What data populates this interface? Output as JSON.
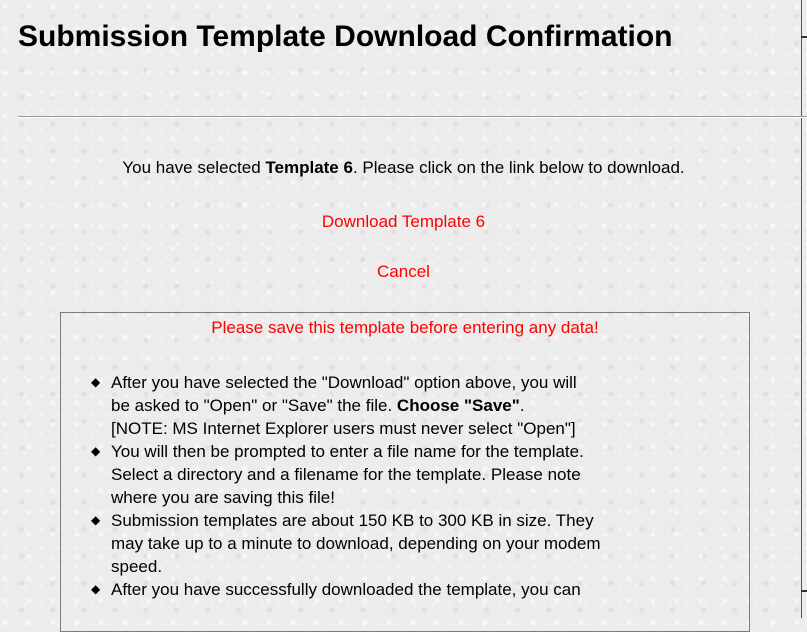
{
  "page": {
    "title": "Submission Template Download Confirmation"
  },
  "intro": {
    "prefix": "You have selected ",
    "template_name": "Template 6",
    "suffix": ". Please click on the link below to download."
  },
  "links": {
    "download": "Download Template 6",
    "cancel": "Cancel"
  },
  "notice": {
    "heading": "Please save this template before entering any data!",
    "items": [
      {
        "line1": "After you have selected the \"Download\" option above, you will",
        "line2_prefix": "be asked to \"Open\" or \"Save\" the file. ",
        "line2_bold": "Choose \"Save\"",
        "line2_suffix": ".",
        "line3": "[NOTE: MS Internet Explorer users must never select \"Open\"]"
      },
      {
        "line1": "You will then be prompted to enter a file name for the template.",
        "line2": "Select a directory and a filename for the template. Please note",
        "line3": "where you are saving this file!"
      },
      {
        "line1": "Submission templates are about 150 KB to 300 KB in size. They",
        "line2": "may take up to a minute to download, depending on your modem",
        "line3": "speed."
      },
      {
        "line1": "After you have successfully downloaded the template, you can"
      }
    ]
  },
  "colors": {
    "link": "#ff0000",
    "background": "#ececec"
  }
}
